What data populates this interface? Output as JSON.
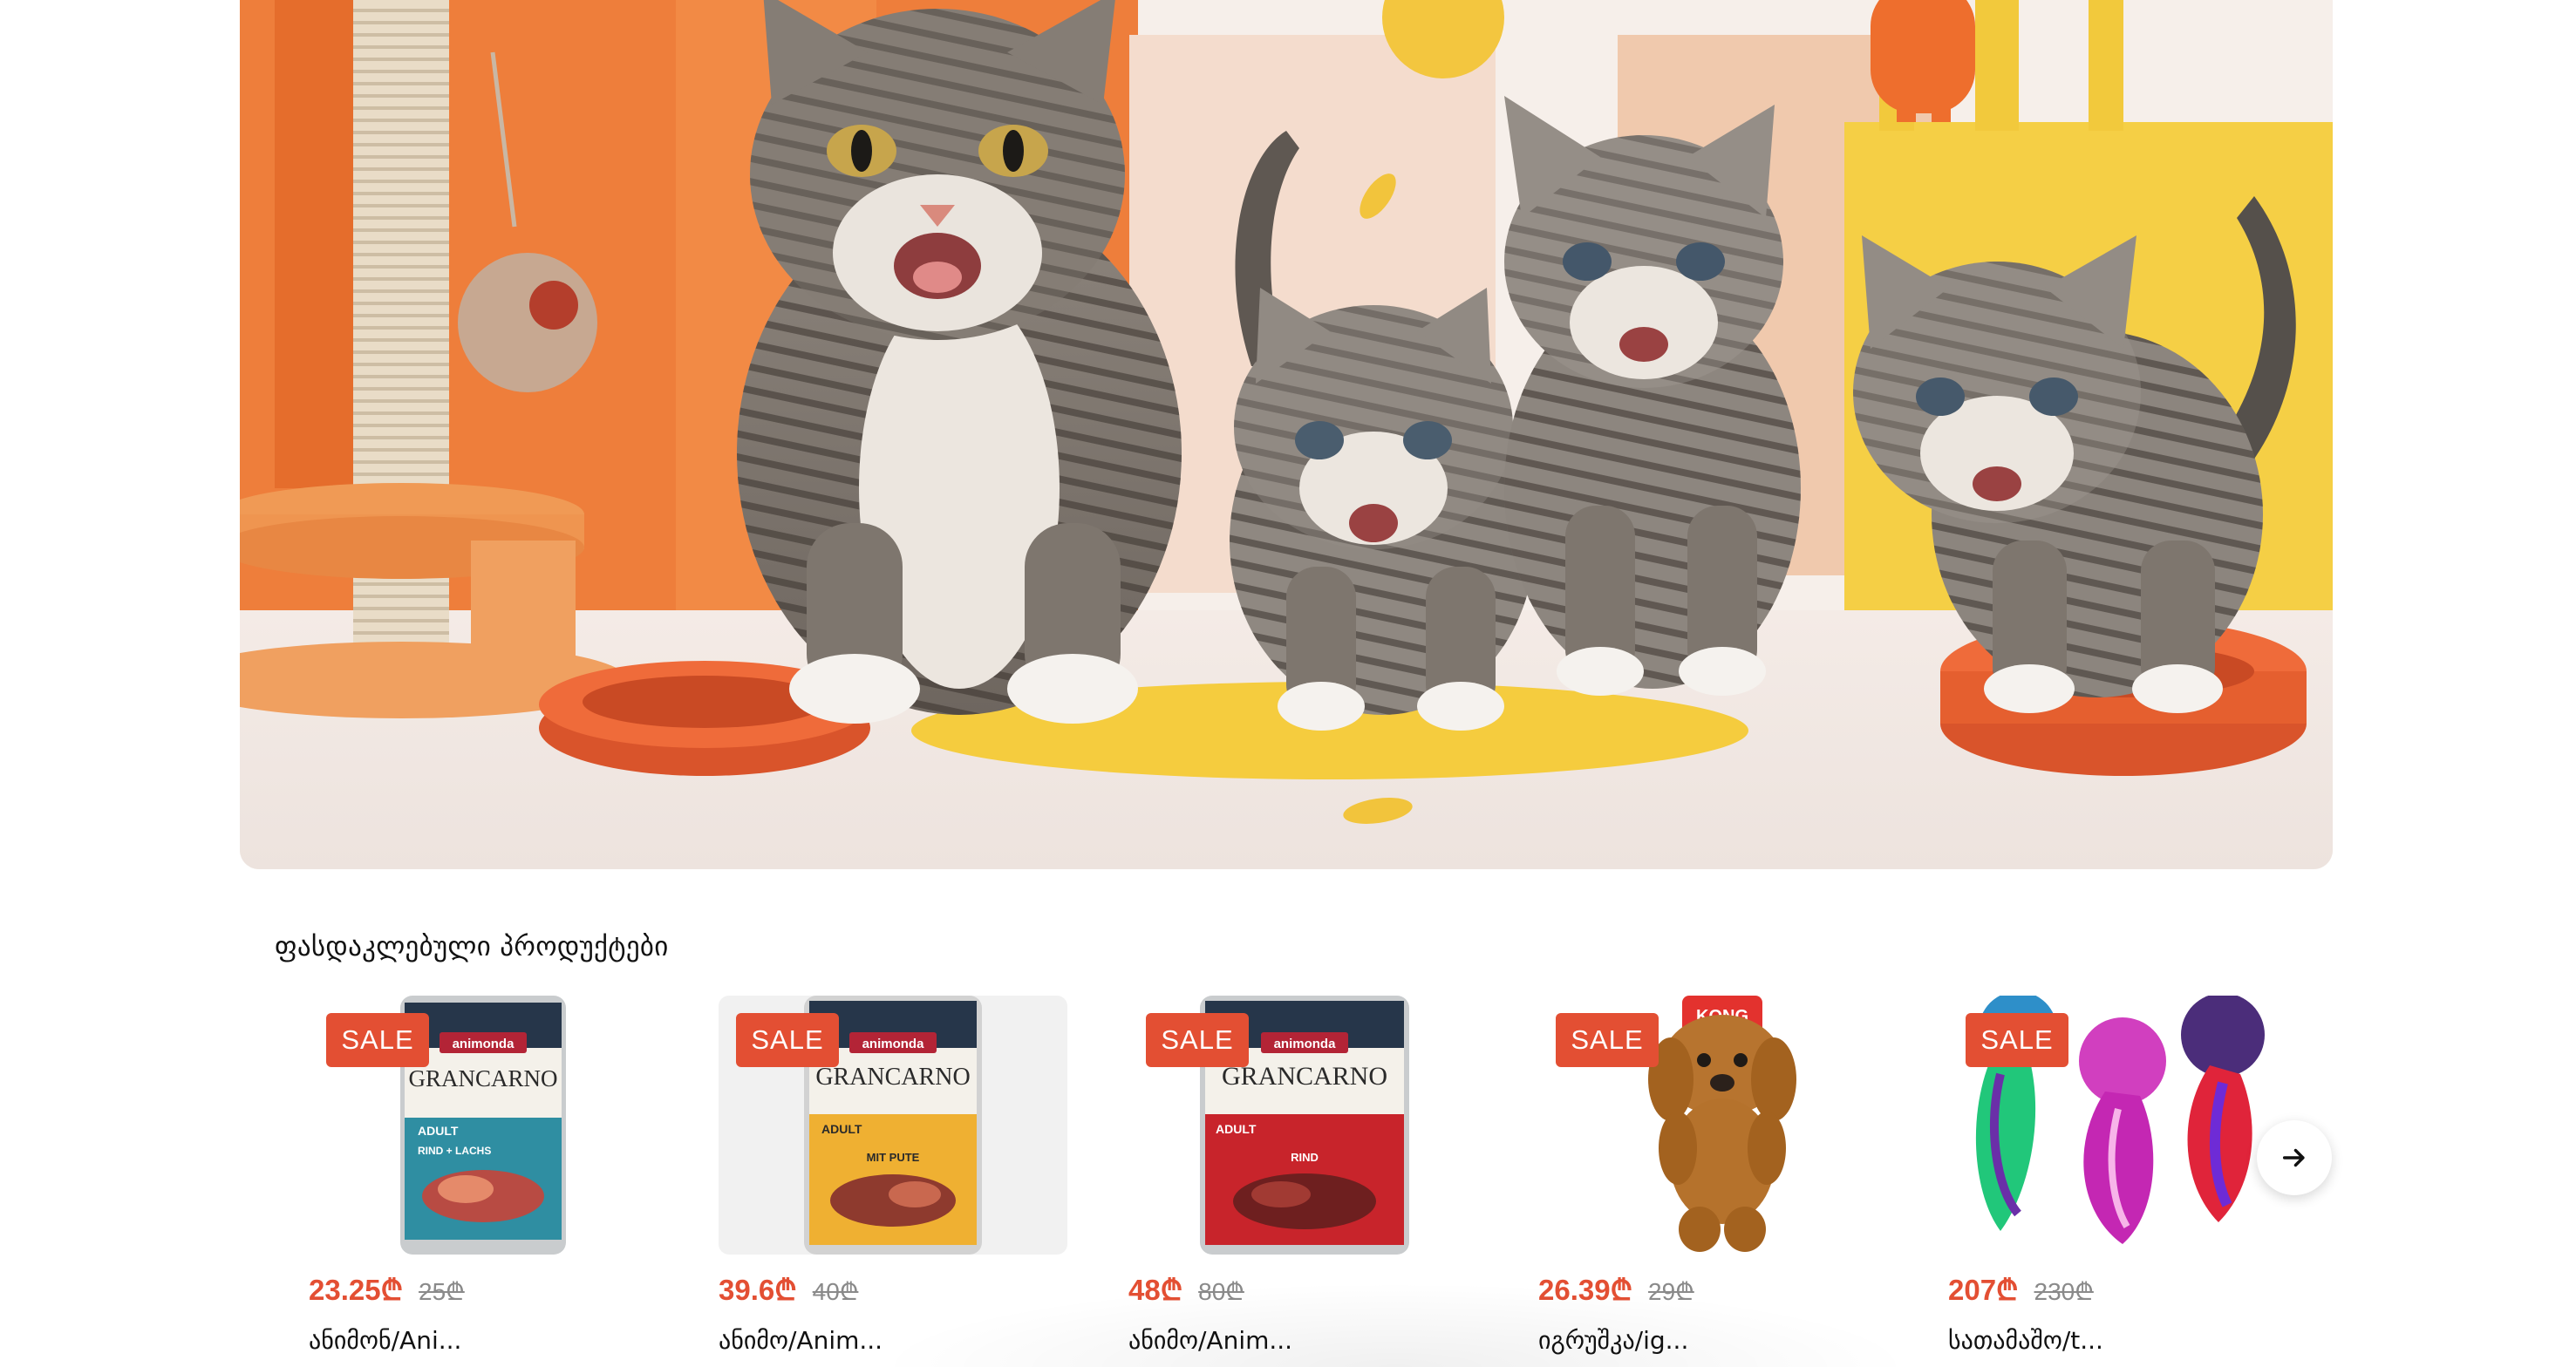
{
  "section": {
    "title": "ფასდაკლებული პროდუქტები"
  },
  "products": [
    {
      "badge": "SALE",
      "price": "23.25₾",
      "old_price": "25₾",
      "name": "ანიმონ/Ani..."
    },
    {
      "badge": "SALE",
      "price": "39.6₾",
      "old_price": "40₾",
      "name": "ანიმო/Anim..."
    },
    {
      "badge": "SALE",
      "price": "48₾",
      "old_price": "80₾",
      "name": "ანიმო/Anim..."
    },
    {
      "badge": "SALE",
      "price": "26.39₾",
      "old_price": "29₾",
      "name": "იგრუშკა/ig..."
    },
    {
      "badge": "SALE",
      "price": "207₾",
      "old_price": "230₾",
      "name": "სათამაშო/t..."
    }
  ],
  "can_labels": {
    "brand": "animonda",
    "line": "GRANCARNO",
    "adult": "ADULT",
    "flavor_1": "RIND + LACHS",
    "flavor_2": "MIT PUTE",
    "flavor_3": "RIND"
  },
  "toy_label": "KONG",
  "icons": {
    "next": "arrow-right-icon"
  },
  "colors": {
    "accent": "#e34f33",
    "old_price": "#8a8a8a"
  }
}
